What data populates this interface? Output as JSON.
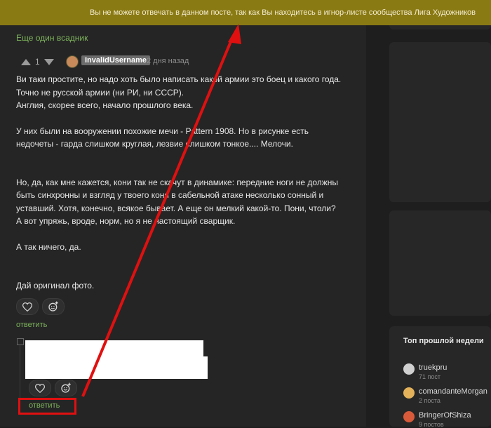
{
  "banner": {
    "text": "Вы не можете отвечать в данном посте, так как Вы находитесь в игнор-листе сообщества Лига Художников"
  },
  "post": {
    "title": "Еще один всадник",
    "rating": "1",
    "username": "InvalidUsername",
    "time": "2 дня назад",
    "paragraphs": [
      "Ви таки простите, но надо хоть было написать какой армии это боец и какого года.\nТочно не русской армии (ни РИ, ни СССР).\nАнглия, скорее всего, начало прошлого века.",
      "У них были на вооружении похожие мечи - Pattern 1908. Но в рисунке есть недочеты - гарда слишком круглая, лезвие слишком тонкое.... Мелочи.",
      "",
      "Но, да, как мне кажется, кони так не скачут в динамике: передние ноги не должны быть синхронны и взгляд у твоего коня в сабельной атаке несколько сонный и уставший. Хотя, конечно, всякое бывает. А еще он мелкий какой-то. Пони, чтоли?\nА вот упряжь, вроде, норм, но я не настоящий сварщик.",
      "А так ничего, да.",
      "",
      "Дай оригинал фото."
    ],
    "reply_label": "ответить"
  },
  "child": {
    "reply_label": "ответить"
  },
  "sidebar": {
    "top_title": "Топ прошлой недели",
    "users": [
      {
        "name": "truekpru",
        "count": "71 пост",
        "avatar_color": "#d0d0d0"
      },
      {
        "name": "comandanteMorgan",
        "count": "2 поста",
        "avatar_color": "#e3b25a"
      },
      {
        "name": "BringerOfShiza",
        "count": "9 постов",
        "avatar_color": "#d85a3a"
      }
    ]
  },
  "colors": {
    "accent_green": "#7cb25b",
    "banner": "#8a7a14",
    "annotation_red": "#e01010"
  }
}
